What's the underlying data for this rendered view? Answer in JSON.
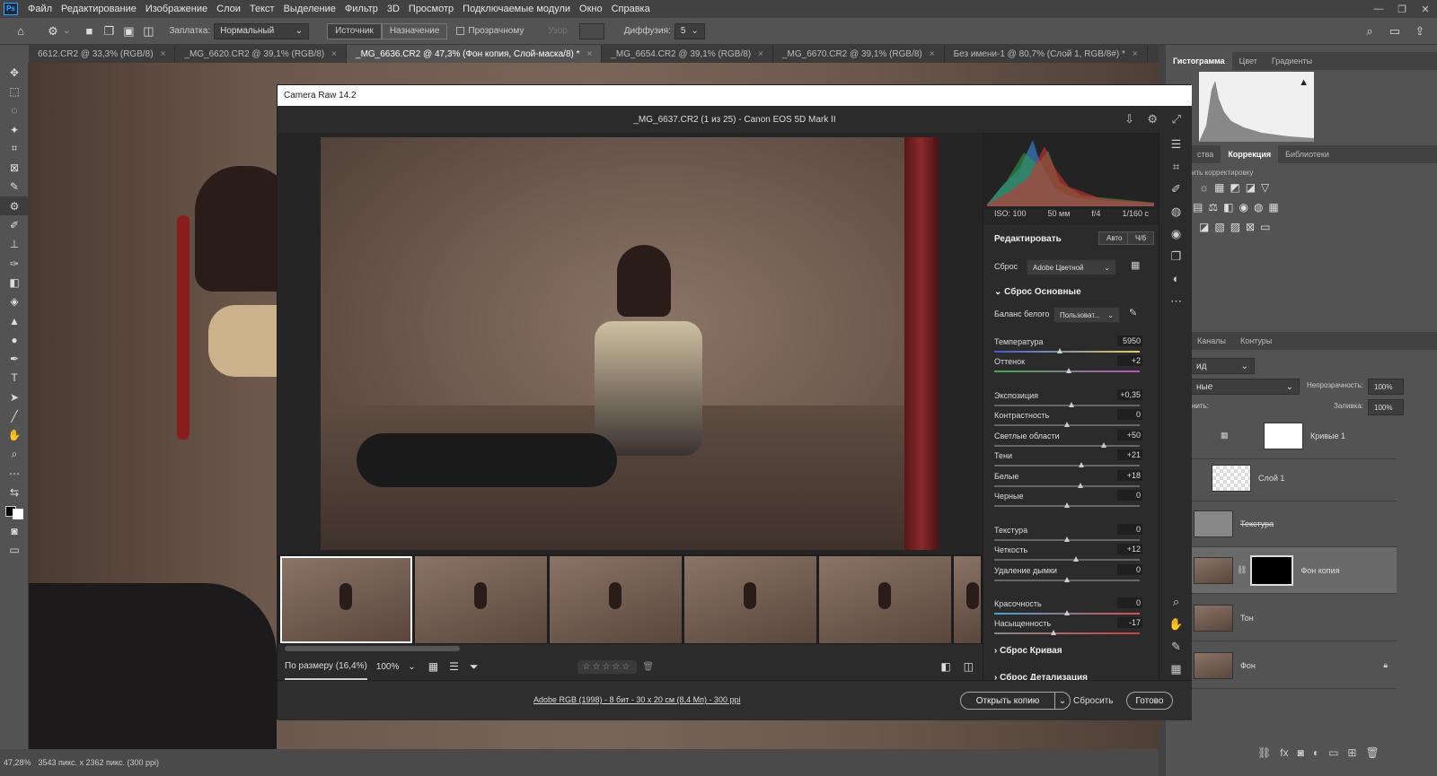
{
  "menubar": {
    "logo": "Ps",
    "items": [
      "Файл",
      "Редактирование",
      "Изображение",
      "Слои",
      "Текст",
      "Выделение",
      "Фильтр",
      "3D",
      "Просмотр",
      "Подключаемые модули",
      "Окно",
      "Справка"
    ],
    "window_buttons": [
      "—",
      "❐",
      "✕"
    ]
  },
  "options": {
    "patch_label": "Заплатка:",
    "patch_mode": "Нормальный",
    "source": "Источник",
    "destination": "Назначение",
    "transparent": "Прозрачному",
    "pattern": "Узор",
    "diffusion_label": "Диффузия:",
    "diffusion_value": "5"
  },
  "doc_tabs": [
    {
      "label": "6612.CR2 @ 33,3% (RGB/8)",
      "active": false
    },
    {
      "label": "_MG_6620.CR2 @ 39,1% (RGB/8)",
      "active": false
    },
    {
      "label": "_MG_6636.CR2 @ 47,3% (Фон копия, Слой-маска/8) *",
      "active": true
    },
    {
      "label": "_MG_6654.CR2 @ 39,1% (RGB/8)",
      "active": false
    },
    {
      "label": "_MG_6670.CR2 @ 39,1% (RGB/8)",
      "active": false
    },
    {
      "label": "Без имени-1 @ 80,7% (Слой 1, RGB/8#) *",
      "active": false
    }
  ],
  "status": {
    "zoom": "47,28%",
    "info": "3543 пикс. x 2362 пикс. (300 ppi)"
  },
  "camera_raw": {
    "title": "Camera Raw 14.2",
    "file_info": "_MG_6637.CR2 (1 из 25)  -  Canon EOS 5D Mark II",
    "zoom_fit": "По размеру (16,4%)",
    "zoom_100": "100%",
    "meta": {
      "iso": "ISO: 100",
      "focal": "50 мм",
      "aperture": "f/4",
      "shutter": "1/160 с"
    },
    "edit_title": "Редактировать",
    "auto": "Авто",
    "bw": "Ч/б",
    "profile_label": "Сброс",
    "profile_value": "Adobe Цветной",
    "basic_section": "Сброс Основные",
    "wb_label": "Баланс белого",
    "wb_value": "Пользоват...",
    "sliders": [
      {
        "label": "Температура",
        "value": "5950",
        "pos": 0.45
      },
      {
        "label": "Оттенок",
        "value": "+2",
        "pos": 0.51
      },
      {
        "label": "Экспозиция",
        "value": "+0,35",
        "pos": 0.53
      },
      {
        "label": "Контрастность",
        "value": "0",
        "pos": 0.5
      },
      {
        "label": "Светлые области",
        "value": "+50",
        "pos": 0.75
      },
      {
        "label": "Тени",
        "value": "+21",
        "pos": 0.6
      },
      {
        "label": "Белые",
        "value": "+18",
        "pos": 0.59
      },
      {
        "label": "Черные",
        "value": "0",
        "pos": 0.5
      },
      {
        "label": "Текстура",
        "value": "0",
        "pos": 0.5
      },
      {
        "label": "Четкость",
        "value": "+12",
        "pos": 0.56
      },
      {
        "label": "Удаление дымки",
        "value": "0",
        "pos": 0.5
      },
      {
        "label": "Красочность",
        "value": "0",
        "pos": 0.5
      },
      {
        "label": "Насыщенность",
        "value": "-17",
        "pos": 0.41
      }
    ],
    "curve_section": "Сброс Кривая",
    "detail_section": "Сброс Детализация",
    "workflow_link": "Adobe RGB (1998) - 8 бит - 30 x 20 см (8,4 Мп) - 300 ppi",
    "open_copy": "Открыть копию",
    "reset": "Сбросить",
    "done": "Готово",
    "stars": "☆☆☆☆☆"
  },
  "panels": {
    "top_tabs": [
      "Гистограмма",
      "Цвет",
      "Градиенты"
    ],
    "adj_tabs": [
      "ства",
      "Коррекция",
      "Библиотеки"
    ],
    "adj_hint": "ить корректировку",
    "layer_tabs": [
      "Каналы",
      "Контуры"
    ],
    "kind": "ид",
    "blend": "ные",
    "opacity_label": "Непрозрачность:",
    "opacity_value": "100%",
    "lock_label": "нить:",
    "fill_label": "Заливка:",
    "fill_value": "100%",
    "layers": [
      {
        "name": "Кривые 1",
        "active": false
      },
      {
        "name": "Слой 1",
        "active": false
      },
      {
        "name": "Текстура",
        "active": false
      },
      {
        "name": "Фон копия",
        "active": true
      },
      {
        "name": "Тон",
        "active": false
      },
      {
        "name": "Фон",
        "active": false
      }
    ]
  }
}
